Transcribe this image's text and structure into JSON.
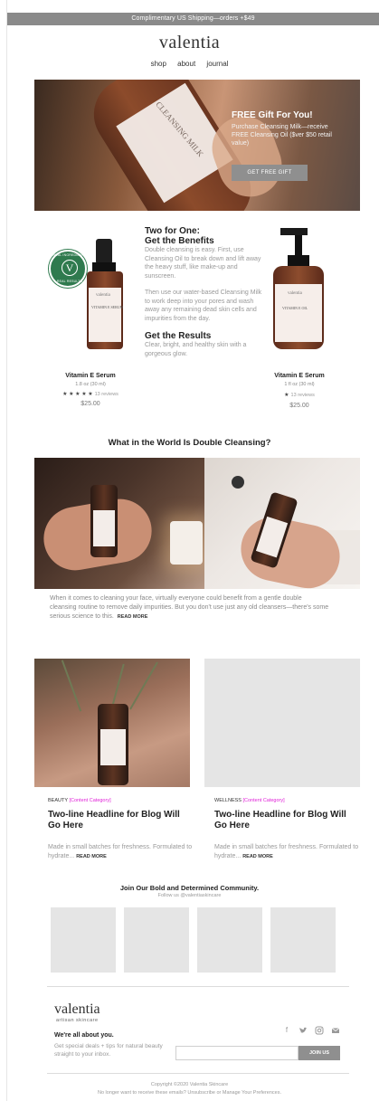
{
  "topbar": {
    "text": "Complimentary US Shipping—orders +$49"
  },
  "header": {
    "logo": "valentia",
    "nav": [
      "shop",
      "about",
      "journal"
    ]
  },
  "hero": {
    "title": "FREE Gift For You!",
    "subtitle": "Purchase Cleansing Milk—receive FREE Cleansing Oil ($ver $50 retail value)",
    "button": "GET FREE GIFT",
    "bottle_label": "CLEANSING MILK",
    "bottle_brand": "valentia"
  },
  "feature": {
    "badge": {
      "letter": "V",
      "top": "REAL INGREDIENTS",
      "bottom": "REAL RESULTS"
    },
    "heading1": "Two for One:",
    "heading2": "Get the Benefits",
    "para1": "Double cleansing is easy. First, use Cleansing Oil to break down and lift away the heavy stuff, like make-up and sunscreen.",
    "para2": "Then use our water-based Cleansing Milk to work deep into your pores and wash away any remaining dead skin cells and impurities from the day.",
    "heading3": "Get the Results",
    "para3": "Clear, bright, and healthy skin with a gorgeous glow.",
    "products": [
      {
        "name": "Vitamin E Serum",
        "size": "1.8 oz (30 ml)",
        "stars": "★ ★ ★ ★ ★",
        "reviews": "13 reviews",
        "price": "$25.00",
        "label_brand": "valentia",
        "label_name": "VITAMIN E SERUM"
      },
      {
        "name": "Vitamin E Serum",
        "size": "1 fl oz (30 ml)",
        "stars": "★",
        "reviews": "13 reviews",
        "price": "$25.00",
        "label_brand": "valentia",
        "label_name": "VITAMIN E OIL"
      }
    ]
  },
  "double_cleansing": {
    "title": "What in the World Is Double Cleansing?",
    "body": "When it comes to cleaning your face, virtually everyone could benefit from a gentle double cleansing routine to remove daily impurities. But you don't use just any old cleansers—there's some serious science to this.",
    "read_more": "READ MORE"
  },
  "blog": [
    {
      "category": "BEAUTY",
      "tag": "[Content Category]",
      "headline": "Two-line Headline for Blog Will Go Here",
      "excerpt": "Made in small batches for freshness. Formulated to hydrate...",
      "read_more": "READ MORE"
    },
    {
      "category": "WELLNESS",
      "tag": "[Content Category]",
      "headline": "Two-line Headline for Blog Will Go Here",
      "excerpt": "Made in small batches for freshness. Formulated to hydrate...",
      "read_more": "READ MORE"
    }
  ],
  "community": {
    "title": "Join Our Bold and Determined Community.",
    "subtitle": "Follow us @valentiaskincare"
  },
  "footer": {
    "logo": "valentia",
    "tagline": "artisan skincare",
    "heading": "We're all about you.",
    "text": "Get special deals + tips for natural beauty straight to your inbox.",
    "social_icons": [
      "facebook-icon",
      "twitter-icon",
      "instagram-icon",
      "mail-icon"
    ],
    "join_button": "JOIN US",
    "copyright": "Copyright ©2020 Valentia Skincare",
    "unsubscribe": "No longer want to receive these emails? Unsubscribe or Manage Your Preferences."
  },
  "colors": {
    "topbar": "#8a8a8a",
    "button": "#8f8f8f",
    "badge": "#2f7a4e",
    "tag": "#e020d8"
  }
}
